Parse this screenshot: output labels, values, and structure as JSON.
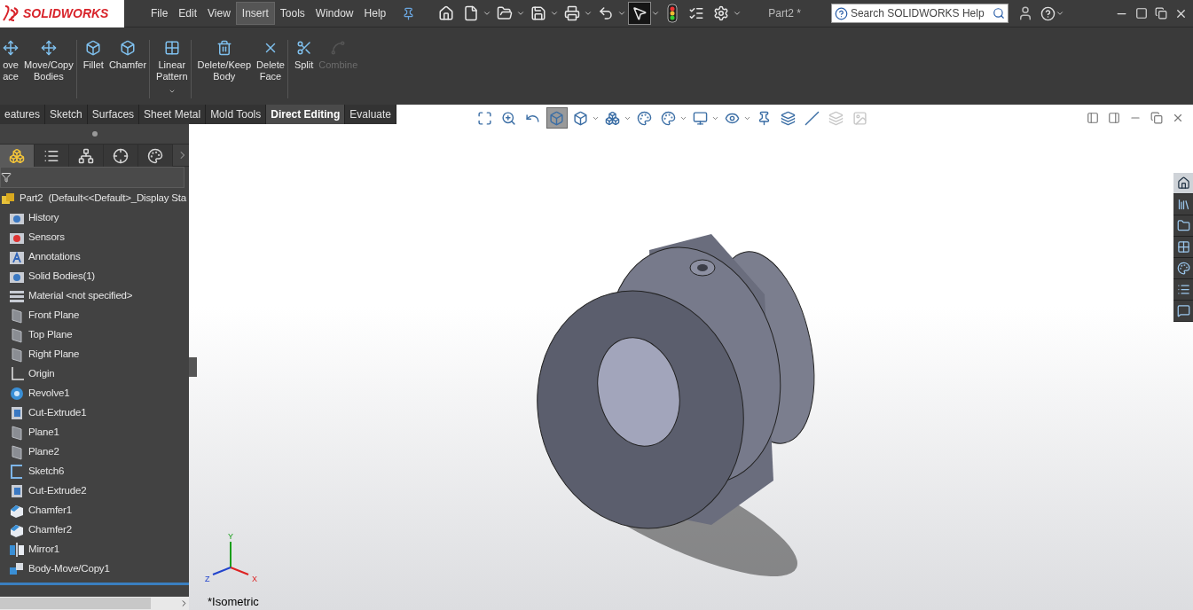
{
  "title_bar": {
    "logo": "SOLIDWORKS",
    "menu": [
      {
        "label": "File",
        "selected": false
      },
      {
        "label": "Edit",
        "selected": false
      },
      {
        "label": "View",
        "selected": false
      },
      {
        "label": "Insert",
        "selected": true
      },
      {
        "label": "Tools",
        "selected": false
      },
      {
        "label": "Window",
        "selected": false
      },
      {
        "label": "Help",
        "selected": false
      }
    ],
    "toolbar": [
      {
        "kind": "home",
        "dropdown": false,
        "selected": false
      },
      {
        "kind": "new",
        "dropdown": true,
        "selected": false
      },
      {
        "kind": "open",
        "dropdown": true,
        "selected": false
      },
      {
        "kind": "save",
        "dropdown": true,
        "selected": false
      },
      {
        "kind": "print",
        "dropdown": true,
        "selected": false
      },
      {
        "kind": "undo",
        "dropdown": true,
        "selected": false
      },
      {
        "kind": "select",
        "dropdown": true,
        "selected": true
      },
      {
        "kind": "rebuild",
        "dropdown": false,
        "selected": false
      },
      {
        "kind": "file_properties",
        "dropdown": false,
        "selected": false
      },
      {
        "kind": "options",
        "dropdown": true,
        "selected": false
      }
    ],
    "document_title": "Part2 *",
    "search": {
      "placeholder": "Search SOLIDWORKS Help"
    }
  },
  "ribbon": [
    {
      "lines": [
        "ove",
        "ace"
      ],
      "kind": "move_face",
      "disabled": false,
      "dropdown": false
    },
    {
      "lines": [
        "Move/Copy",
        "Bodies"
      ],
      "kind": "move_bodies",
      "disabled": false,
      "dropdown": false
    },
    {
      "lines": [
        "Fillet"
      ],
      "kind": "fillet",
      "disabled": false,
      "dropdown": false
    },
    {
      "lines": [
        "Chamfer"
      ],
      "kind": "chamfer",
      "disabled": false,
      "dropdown": false
    },
    {
      "lines": [
        "Linear",
        "Pattern"
      ],
      "kind": "pattern",
      "disabled": false,
      "dropdown": true
    },
    {
      "lines": [
        "Delete/Keep",
        "Body"
      ],
      "kind": "delete_body",
      "disabled": false,
      "dropdown": false
    },
    {
      "lines": [
        "Delete",
        "Face"
      ],
      "kind": "delete_face",
      "disabled": false,
      "dropdown": false
    },
    {
      "lines": [
        "Split"
      ],
      "kind": "split",
      "disabled": false,
      "dropdown": false
    },
    {
      "lines": [
        "Combine"
      ],
      "kind": "combine",
      "disabled": true,
      "dropdown": false
    }
  ],
  "command_tabs": [
    {
      "label": "eatures",
      "selected": false
    },
    {
      "label": "Sketch",
      "selected": false
    },
    {
      "label": "Surfaces",
      "selected": false
    },
    {
      "label": "Sheet Metal",
      "selected": false
    },
    {
      "label": "Mold Tools",
      "selected": false
    },
    {
      "label": "Direct Editing",
      "selected": true
    },
    {
      "label": "Evaluate",
      "selected": false
    }
  ],
  "panel_tabs": [
    {
      "kind": "feature_manager",
      "selected": true
    },
    {
      "kind": "property_manager",
      "selected": false
    },
    {
      "kind": "configuration_manager",
      "selected": false
    },
    {
      "kind": "dim_expert",
      "selected": false
    },
    {
      "kind": "display_manager",
      "selected": false
    }
  ],
  "feature_tree": {
    "label": "Part2  (Default<<Default>_Display Sta",
    "kind": "part",
    "children": [
      {
        "label": "History",
        "kind": "history"
      },
      {
        "label": "Sensors",
        "kind": "sensors"
      },
      {
        "label": "Annotations",
        "kind": "annotations"
      },
      {
        "label": "Solid Bodies(1)",
        "kind": "bodies"
      },
      {
        "label": "Material <not specified>",
        "kind": "material"
      },
      {
        "label": "Front Plane",
        "kind": "plane"
      },
      {
        "label": "Top Plane",
        "kind": "plane"
      },
      {
        "label": "Right Plane",
        "kind": "plane"
      },
      {
        "label": "Origin",
        "kind": "origin"
      },
      {
        "label": "Revolve1",
        "kind": "revolve"
      },
      {
        "label": "Cut-Extrude1",
        "kind": "cut"
      },
      {
        "label": "Plane1",
        "kind": "plane"
      },
      {
        "label": "Plane2",
        "kind": "plane"
      },
      {
        "label": "Sketch6",
        "kind": "sketch"
      },
      {
        "label": "Cut-Extrude2",
        "kind": "cut"
      },
      {
        "label": "Chamfer1",
        "kind": "chamfer"
      },
      {
        "label": "Chamfer2",
        "kind": "chamfer"
      },
      {
        "label": "Mirror1",
        "kind": "mirror"
      },
      {
        "label": "Body-Move/Copy1",
        "kind": "move"
      }
    ]
  },
  "heads_up_toolbar": [
    {
      "kind": "zoom_fit",
      "selected": false,
      "disabled": false,
      "dropdown": false
    },
    {
      "kind": "zoom_area",
      "selected": false,
      "disabled": false,
      "dropdown": false
    },
    {
      "kind": "previous_view",
      "selected": false,
      "disabled": false,
      "dropdown": false
    },
    {
      "kind": "section_view",
      "selected": true,
      "disabled": false,
      "dropdown": false
    },
    {
      "kind": "view_orientation",
      "selected": false,
      "disabled": false,
      "dropdown": true
    },
    {
      "kind": "display_style",
      "selected": false,
      "disabled": false,
      "dropdown": true
    },
    {
      "kind": "edit_appearance",
      "selected": false,
      "disabled": false,
      "dropdown": false
    },
    {
      "kind": "scene",
      "selected": false,
      "disabled": false,
      "dropdown": true
    },
    {
      "kind": "view_settings",
      "selected": false,
      "disabled": false,
      "dropdown": true
    },
    {
      "kind": "hide_show",
      "selected": false,
      "disabled": false,
      "dropdown": true
    },
    {
      "kind": "axis",
      "selected": false,
      "disabled": false,
      "dropdown": false
    },
    {
      "kind": "plane",
      "selected": false,
      "disabled": false,
      "dropdown": false
    },
    {
      "kind": "line",
      "selected": false,
      "disabled": false,
      "dropdown": false
    },
    {
      "kind": "realview",
      "selected": false,
      "disabled": true,
      "dropdown": false
    },
    {
      "kind": "image",
      "selected": false,
      "disabled": true,
      "dropdown": false
    }
  ],
  "task_pane": [
    {
      "kind": "home",
      "selected": true
    },
    {
      "kind": "library",
      "selected": false
    },
    {
      "kind": "explorer",
      "selected": false
    },
    {
      "kind": "palette",
      "selected": false
    },
    {
      "kind": "appearances",
      "selected": false
    },
    {
      "kind": "properties",
      "selected": false
    },
    {
      "kind": "forum",
      "selected": false
    }
  ],
  "viewport": {
    "triad_labels": {
      "y": "Y",
      "z": "Z",
      "x": "X"
    },
    "view_label": "*Isometric"
  }
}
